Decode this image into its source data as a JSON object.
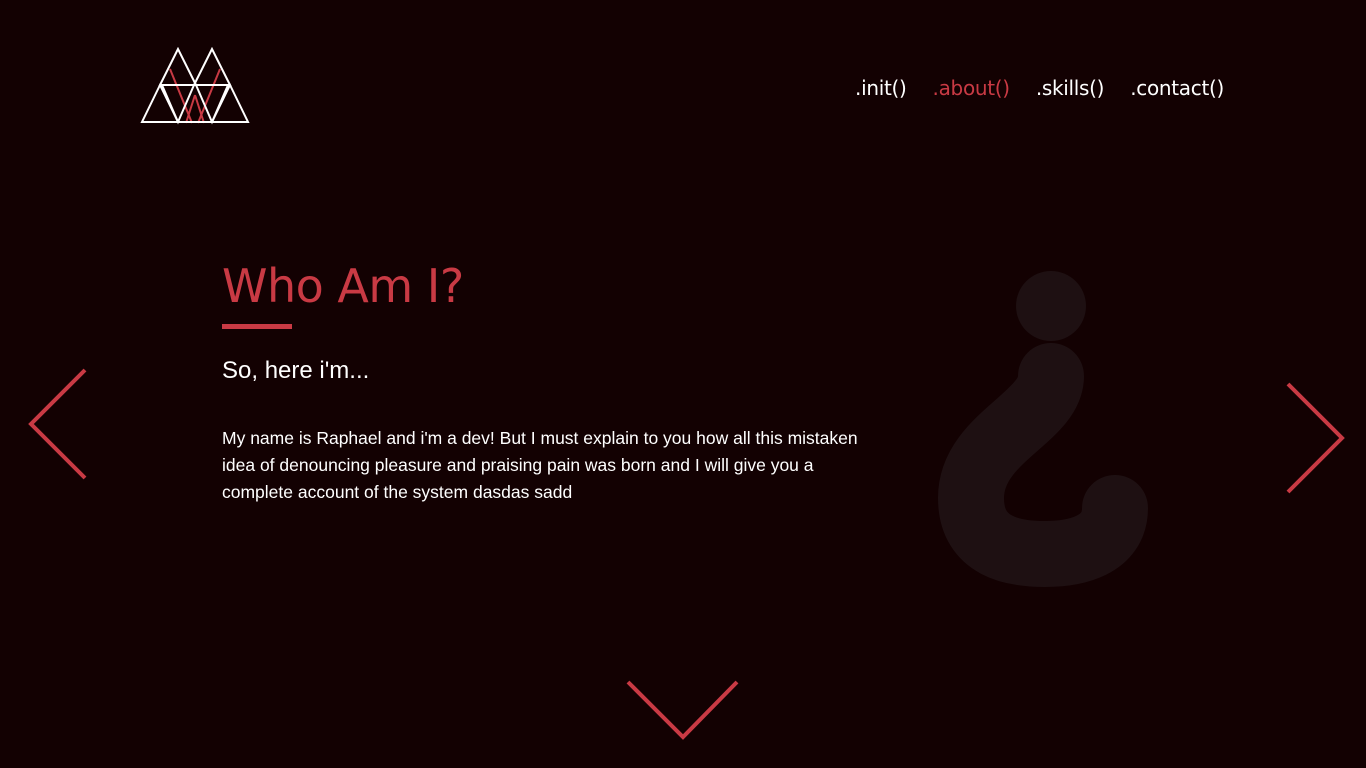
{
  "colors": {
    "background": "#130102",
    "accent": "#c93a44",
    "text": "#ffffff",
    "watermark": "#1e1012"
  },
  "logo": {
    "icon": "triangles-logo-icon"
  },
  "nav": {
    "items": [
      {
        "label": ".init()",
        "active": false
      },
      {
        "label": ".about()",
        "active": true
      },
      {
        "label": ".skills()",
        "active": false
      },
      {
        "label": ".contact()",
        "active": false
      }
    ]
  },
  "main": {
    "title": "Who Am I?",
    "subtitle": "So, here i'm...",
    "description": "My name is Raphael and i'm a dev! But I must explain to you how all this mistaken idea of denouncing pleasure and praising pain was born and I will give you a complete account of the system dasdas sadd"
  },
  "decoration": {
    "watermark_icon": "inverted-question-mark-icon"
  },
  "navigation_arrows": {
    "left": "chevron-left-icon",
    "right": "chevron-right-icon",
    "down": "chevron-down-icon"
  }
}
